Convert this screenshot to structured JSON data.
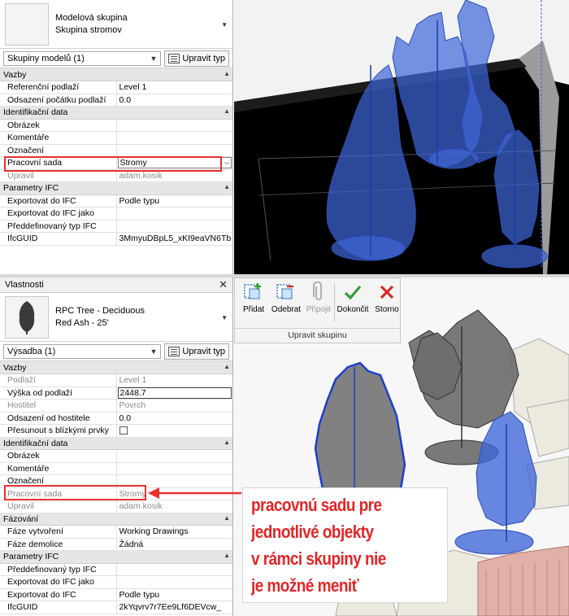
{
  "top_panel": {
    "type_selector": {
      "line1": "Modelová skupina",
      "line2": "Skupina stromov"
    },
    "filter": {
      "selected": "Skupiny modelů (1)",
      "edit_type_label": "Upravit typ"
    },
    "groups": [
      {
        "name": "Vazby",
        "rows": [
          {
            "label": "Referenční podlaží",
            "value": "Level 1"
          },
          {
            "label": "Odsazení počátku podlaží",
            "value": "0.0"
          }
        ]
      },
      {
        "name": "Identifikační data",
        "rows": [
          {
            "label": "Obrázek",
            "value": ""
          },
          {
            "label": "Komentáře",
            "value": ""
          },
          {
            "label": "Označení",
            "value": ""
          },
          {
            "label": "Pracovní sada",
            "value": "Stromy"
          },
          {
            "label": "Upravil",
            "value": "adam.kosik"
          }
        ]
      },
      {
        "name": "Parametry IFC",
        "rows": [
          {
            "label": "Exportovat do IFC",
            "value": "Podle typu"
          },
          {
            "label": "Exportovat do IFC jako",
            "value": ""
          },
          {
            "label": "Předdefinovaný typ IFC",
            "value": ""
          },
          {
            "label": "IfcGUID",
            "value": "3MmyuDBpL5_xKI9eaVN6Tb"
          }
        ]
      }
    ]
  },
  "bottom_panel": {
    "title": "Vlastnosti",
    "type_selector": {
      "line1": "RPC Tree - Deciduous",
      "line2": "Red Ash - 25'"
    },
    "filter": {
      "selected": "Výsadba (1)",
      "edit_type_label": "Upravit typ"
    },
    "groups": [
      {
        "name": "Vazby",
        "rows": [
          {
            "label": "Podlaží",
            "value": "Level 1"
          },
          {
            "label": "Výška od podlaží",
            "value": "2448.7"
          },
          {
            "label": "Hostitel",
            "value": "Povrch"
          },
          {
            "label": "Odsazení od hostitele",
            "value": "0.0"
          },
          {
            "label": "Přesunout s blízkými prvky",
            "value": ""
          }
        ]
      },
      {
        "name": "Identifikační data",
        "rows": [
          {
            "label": "Obrázek",
            "value": ""
          },
          {
            "label": "Komentáře",
            "value": ""
          },
          {
            "label": "Označení",
            "value": ""
          },
          {
            "label": "Pracovní sada",
            "value": "Stromy"
          },
          {
            "label": "Upravil",
            "value": "adam.kosik"
          }
        ]
      },
      {
        "name": "Fázování",
        "rows": [
          {
            "label": "Fáze vytvoření",
            "value": "Working Drawings"
          },
          {
            "label": "Fáze demolice",
            "value": "Žádná"
          }
        ]
      },
      {
        "name": "Parametry IFC",
        "rows": [
          {
            "label": "Předdefinovaný typ IFC",
            "value": ""
          },
          {
            "label": "Exportovat do IFC jako",
            "value": ""
          },
          {
            "label": "Exportovat do IFC",
            "value": "Podle typu"
          },
          {
            "label": "IfcGUID",
            "value": "2kYqvrv7r7Ee9Lf6DEVcw_"
          }
        ]
      }
    ]
  },
  "ribbon": {
    "buttons": [
      "Přidat",
      "Odebrat",
      "Připojit",
      "Dokončit",
      "Storno"
    ],
    "panel_label": "Upravit skupinu"
  },
  "callout": {
    "lines": [
      "pracovnú sadu pre",
      "jednotlivé objekty",
      "v rámci skupiny nie",
      "je možné meniť"
    ]
  },
  "colors": {
    "highlight": "#e83030",
    "tree_blue": "#3f66d8",
    "tree_gray": "#6e6e6e",
    "callout_text": "#e12626"
  }
}
